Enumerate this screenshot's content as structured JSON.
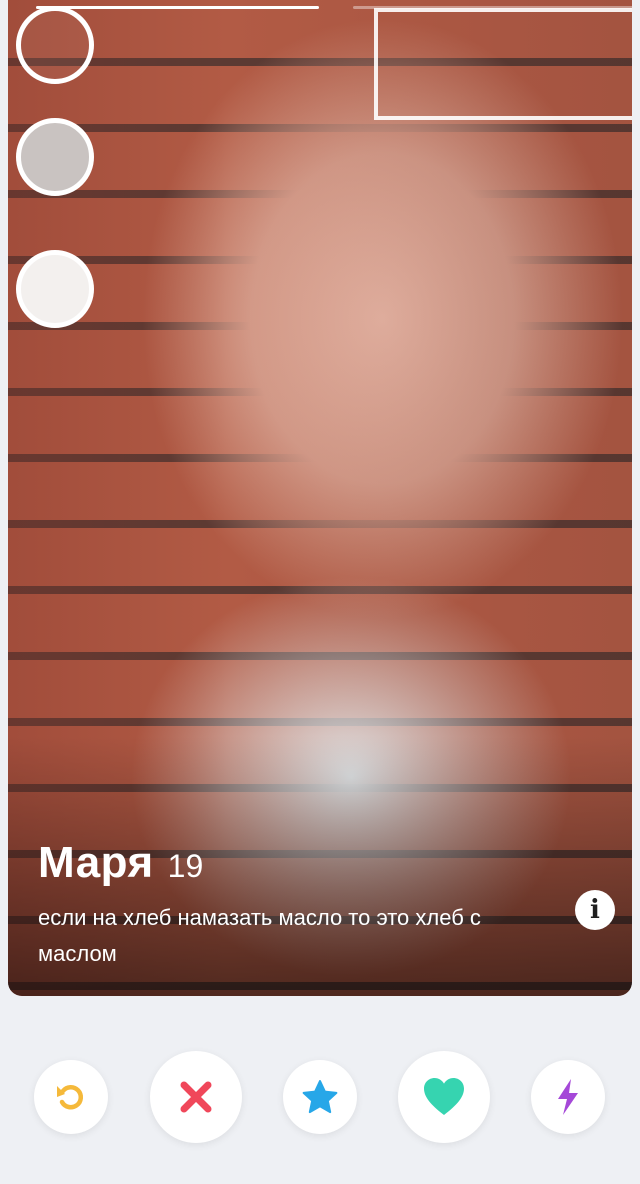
{
  "profile": {
    "name": "Маря",
    "age": "19",
    "bio": "если на хлеб намазать масло то это хлеб с маслом"
  },
  "photo_progress": {
    "segments": 2,
    "active_index": 0
  },
  "icons": {
    "info": "i",
    "rewind": "rewind-icon",
    "nope": "close-icon",
    "super_like": "star-icon",
    "like": "heart-icon",
    "boost": "lightning-icon"
  },
  "colors": {
    "rewind": "#f5b93a",
    "nope": "#f0475a",
    "super_like": "#27a7e8",
    "like": "#36d4b0",
    "boost": "#a548d8"
  }
}
